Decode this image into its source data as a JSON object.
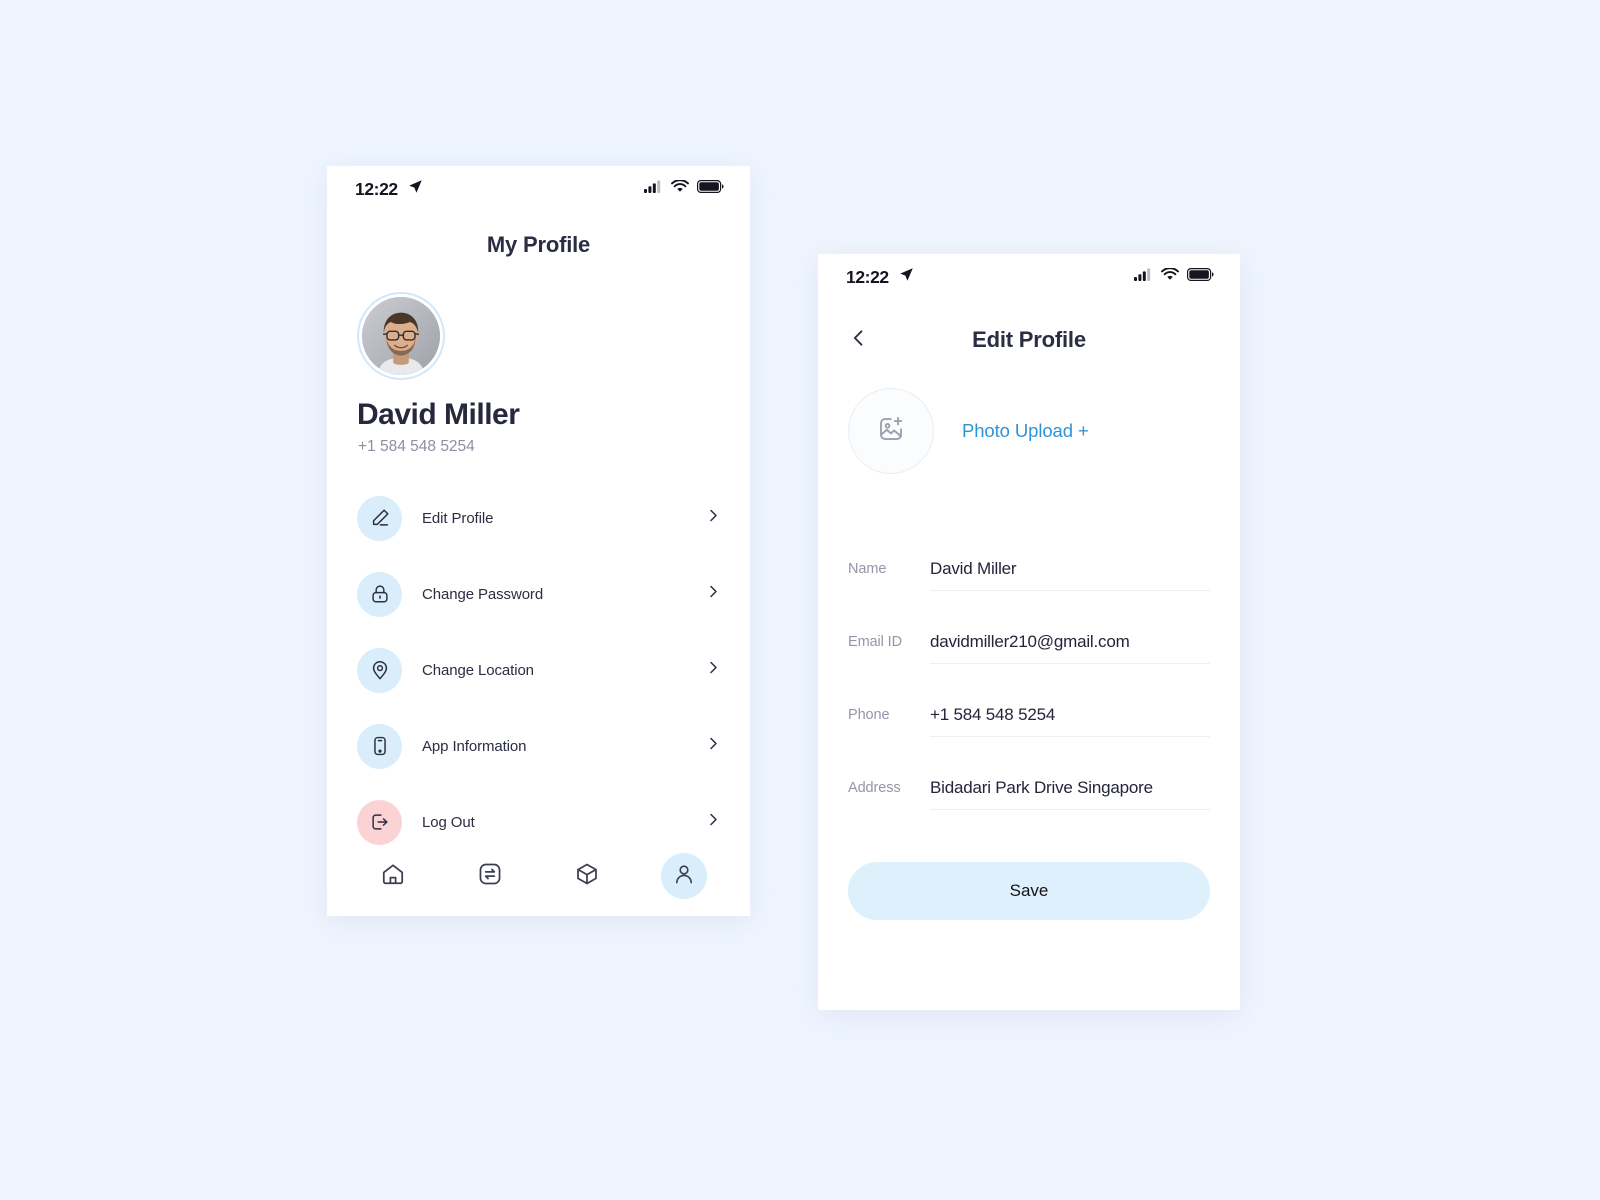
{
  "theme": {
    "page_bg": "#eff5fe",
    "accent_blue": "#2e94d8",
    "icon_bubble": "#d9edfb",
    "icon_bubble_danger": "#fbd3d5",
    "text_dark": "#2b2d42",
    "text_muted": "#9396a8",
    "save_bg": "#ddf0fc"
  },
  "profile_screen": {
    "status_bar": {
      "time": "12:22",
      "location_icon": "location-arrow-icon",
      "signal_icon": "cellular-signal-icon",
      "wifi_icon": "wifi-icon",
      "battery_icon": "battery-full-icon"
    },
    "title": "My Profile",
    "avatar_icon": "user-avatar-photo",
    "name": "David Miller",
    "phone": "+1 584 548 5254",
    "menu_items": [
      {
        "label": "Edit Profile",
        "icon": "pencil-icon",
        "chevron": "chevron-right-icon",
        "tone": "blue"
      },
      {
        "label": "Change Password",
        "icon": "lock-icon",
        "chevron": "chevron-right-icon",
        "tone": "blue"
      },
      {
        "label": "Change Location",
        "icon": "map-pin-icon",
        "chevron": "chevron-right-icon",
        "tone": "blue"
      },
      {
        "label": "App Information",
        "icon": "mobile-phone-icon",
        "chevron": "chevron-right-icon",
        "tone": "blue"
      },
      {
        "label": "Log Out",
        "icon": "logout-icon",
        "chevron": "chevron-right-icon",
        "tone": "red"
      }
    ],
    "tabs": [
      {
        "name": "home",
        "icon": "home-icon",
        "active": false
      },
      {
        "name": "transfer",
        "icon": "transfer-icon",
        "active": false
      },
      {
        "name": "orders",
        "icon": "cube-icon",
        "active": false
      },
      {
        "name": "profile",
        "icon": "person-icon",
        "active": true
      }
    ]
  },
  "edit_screen": {
    "status_bar": {
      "time": "12:22",
      "location_icon": "location-arrow-icon",
      "signal_icon": "cellular-signal-icon",
      "wifi_icon": "wifi-icon",
      "battery_icon": "battery-full-icon"
    },
    "back_icon": "chevron-left-icon",
    "title": "Edit Profile",
    "upload": {
      "icon": "image-add-icon",
      "link_label": "Photo Upload +"
    },
    "fields": [
      {
        "label": "Name",
        "value": "David Miller",
        "placeholder": "Name"
      },
      {
        "label": "Email ID",
        "value": "davidmiller210@gmail.com",
        "placeholder": "Email ID"
      },
      {
        "label": "Phone",
        "value": "+1 584 548 5254",
        "placeholder": "Phone"
      },
      {
        "label": "Address",
        "value": "Bidadari Park Drive Singapore",
        "placeholder": "Address"
      }
    ],
    "save_label": "Save"
  }
}
